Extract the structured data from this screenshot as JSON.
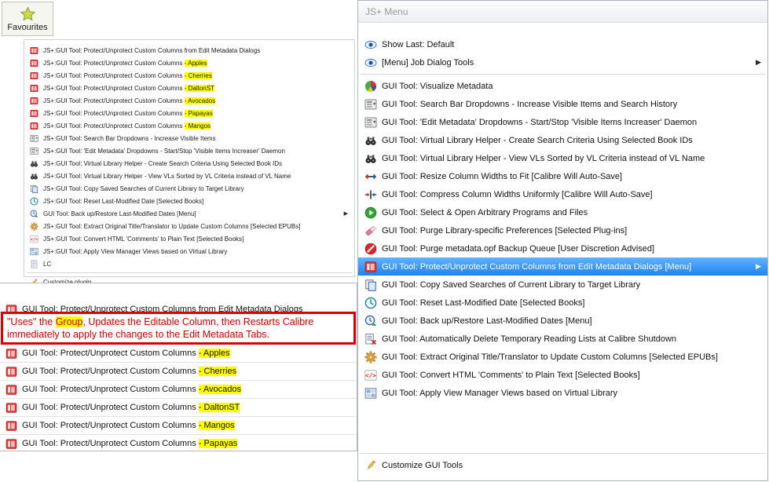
{
  "colors": {
    "selection_blue": "#2f8ef5",
    "highlight_yellow": "#ffff00",
    "annotation_red": "#d90000"
  },
  "favourites": {
    "label": "Favourites",
    "icon": "star-icon"
  },
  "small_menu": {
    "items": [
      {
        "icon": "protect-icon",
        "text": "JS+:GUI Tool:  Protect/Unprotect Custom Columns from Edit Metadata Dialogs"
      },
      {
        "icon": "protect-icon",
        "text": "JS+:GUI Tool:  Protect/Unprotect Custom Columns ",
        "highlight": "- Apples"
      },
      {
        "icon": "protect-icon",
        "text": "JS+:GUI Tool:  Protect/Unprotect Custom Columns ",
        "highlight": "- Cherries"
      },
      {
        "icon": "protect-icon",
        "text": "JS+:GUI Tool:  Protect/Unprotect Custom Columns ",
        "highlight": "- DaltonST"
      },
      {
        "icon": "protect-icon",
        "text": "JS+:GUI Tool:  Protect/Unprotect Custom Columns ",
        "highlight": "- Avocados"
      },
      {
        "icon": "protect-icon",
        "text": "JS+:GUI Tool:  Protect/Unprotect Custom Columns ",
        "highlight": "- Papayas"
      },
      {
        "icon": "protect-icon",
        "text": "JS+:GUI Tool:  Protect/Unprotect Custom Columns ",
        "highlight": "- Mangos"
      },
      {
        "icon": "dropdown-icon",
        "text": "JS+:GUI Tool:  Search Bar Dropdowns - Increase Visible Items"
      },
      {
        "icon": "dropdown-icon",
        "text": "JS+:GUI Tool:  'Edit Metadata' Dropdowns - Start/Stop 'Visible Items Increaser' Daemon"
      },
      {
        "icon": "binoculars-icon",
        "text": "JS+:GUI Tool:  Virtual Library Helper - Create Search Criteria Using Selected Book IDs"
      },
      {
        "icon": "binoculars-icon",
        "text": "JS+:GUI Tool:  Virtual Library Helper - View VLs Sorted by VL Criteria instead of VL Name"
      },
      {
        "icon": "copy-icon",
        "text": "JS+:GUI Tool:  Copy Saved Searches of Current Library to Target Library"
      },
      {
        "icon": "clock-icon",
        "text": "JS+:GUI Tool:  Reset Last-Modified Date [Selected Books]"
      },
      {
        "icon": "clock-backup-icon",
        "text": "GUI Tool:  Back up/Restore Last-Modified Dates [Menu]",
        "submenu": true
      },
      {
        "icon": "gear-icon",
        "text": "JS+:GUI Tool:  Extract Original Title/Translator to Update Custom Columns [Selected EPUBs]"
      },
      {
        "icon": "code-icon",
        "text": "JS+:GUI Tool:  Convert HTML 'Comments' to Plain Text [Selected Books]"
      },
      {
        "icon": "grid-icon",
        "text": "JS+:GUI Tool:  Apply View Manager Views based on Virtual Library"
      },
      {
        "icon": "doc-icon",
        "text": "LC"
      },
      {
        "type": "separator"
      },
      {
        "icon": "pencil-icon",
        "text": "Customize plugin..."
      }
    ]
  },
  "bottom_menu": {
    "clipped_items": [
      {
        "icon": "protect-icon",
        "text": "GUI Tool:  Protect/Unprotect Custom Columns from Edit Metadata Dialogs"
      }
    ],
    "annotation": {
      "pre": "\"Uses\" the ",
      "hl": "Group",
      "post": ", Updates the Editable Column, then Restarts Calibre",
      "line2": "immediately to apply the changes to the Edit Metadata Tabs."
    },
    "items": [
      {
        "icon": "protect-icon",
        "text": "GUI Tool:  Protect/Unprotect Custom Columns ",
        "highlight": "- Apples"
      },
      {
        "icon": "protect-icon",
        "text": "GUI Tool:  Protect/Unprotect Custom Columns ",
        "highlight": "- Cherries"
      },
      {
        "icon": "protect-icon",
        "text": "GUI Tool:  Protect/Unprotect Custom Columns ",
        "highlight": "- Avocados"
      },
      {
        "icon": "protect-icon",
        "text": "GUI Tool:  Protect/Unprotect Custom Columns ",
        "highlight": "- DaltonST"
      },
      {
        "icon": "protect-icon",
        "text": "GUI Tool:  Protect/Unprotect Custom Columns ",
        "highlight": "- Mangos"
      },
      {
        "icon": "protect-icon",
        "text": "GUI Tool:  Protect/Unprotect Custom Columns ",
        "highlight": "- Papayas"
      }
    ]
  },
  "js_menu": {
    "title": "JS+ Menu",
    "items": [
      {
        "icon": "eye-icon",
        "text": "Show Last: Default"
      },
      {
        "icon": "eye-icon",
        "text": "[Menu] Job Dialog Tools",
        "submenu": true
      },
      {
        "type": "separator"
      },
      {
        "icon": "pie-icon",
        "text": "GUI Tool:  Visualize Metadata"
      },
      {
        "icon": "dropdown-icon",
        "text": "GUI Tool:  Search Bar Dropdowns - Increase Visible Items and Search History"
      },
      {
        "icon": "dropdown-icon",
        "text": "GUI Tool:  'Edit Metadata' Dropdowns - Start/Stop 'Visible Items Increaser' Daemon"
      },
      {
        "icon": "binoculars-icon",
        "text": "GUI Tool:  Virtual Library Helper - Create Search Criteria Using Selected Book IDs"
      },
      {
        "icon": "binoculars-icon",
        "text": "GUI Tool:  Virtual Library Helper - View VLs Sorted by VL Criteria instead of VL Name"
      },
      {
        "icon": "resize-icon",
        "text": "GUI Tool:  Resize Column Widths to Fit [Calibre Will Auto-Save]"
      },
      {
        "icon": "compress-icon",
        "text": "GUI Tool:  Compress Column Widths Uniformly [Calibre Will Auto-Save]"
      },
      {
        "icon": "play-icon",
        "text": "GUI Tool:  Select & Open Arbitrary Programs and Files"
      },
      {
        "icon": "eraser-icon",
        "text": "GUI Tool:  Purge Library-specific Preferences [Selected Plug-ins]"
      },
      {
        "icon": "noentry-icon",
        "text": "GUI Tool:  Purge metadata.opf Backup Queue [User Discretion Advised]"
      },
      {
        "icon": "protect-icon",
        "text": "GUI Tool:  Protect/Unprotect Custom Columns from Edit Metadata Dialogs [Menu]",
        "selected": true,
        "submenu": true
      },
      {
        "icon": "copy-icon",
        "text": "GUI Tool:  Copy Saved Searches of Current Library to Target Library"
      },
      {
        "icon": "clock-icon",
        "text": "GUI Tool:  Reset Last-Modified Date [Selected Books]"
      },
      {
        "icon": "clock-backup-icon",
        "text": "GUI Tool:  Back up/Restore Last-Modified Dates [Menu]"
      },
      {
        "icon": "delete-list-icon",
        "text": "GUI Tool:  Automatically Delete Temporary Reading Lists at Calibre Shutdown"
      },
      {
        "icon": "gear-icon",
        "text": "GUI Tool:  Extract Original Title/Translator to Update Custom Columns [Selected EPUBs]"
      },
      {
        "icon": "code-icon",
        "text": "GUI Tool:  Convert HTML 'Comments' to Plain Text [Selected Books]"
      },
      {
        "icon": "grid-icon",
        "text": "GUI Tool:  Apply View Manager Views based on Virtual Library"
      },
      {
        "type": "spacer"
      },
      {
        "type": "separator"
      },
      {
        "icon": "pencil-icon",
        "text": "Customize GUI Tools"
      }
    ]
  }
}
